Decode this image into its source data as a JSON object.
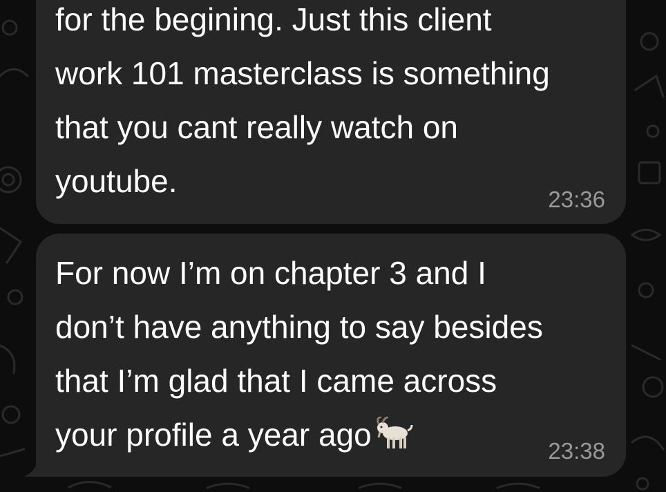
{
  "chat": {
    "messages": [
      {
        "text": "for the begining. Just this client\nwork 101 masterclass is something\nthat you cant really watch on\nyoutube.",
        "time": "23:36"
      },
      {
        "text": "For now I’m on chapter 3 and I\ndon’t have anything to say besides\nthat I’m glad that I came across\nyour profile a year ago",
        "time": "23:38",
        "trailing_icon": "goat-emoji-icon"
      }
    ],
    "colors": {
      "background": "#0d0d0d",
      "bubble": "#262626",
      "text": "#ffffff",
      "timestamp": "#9a9a9a"
    }
  }
}
